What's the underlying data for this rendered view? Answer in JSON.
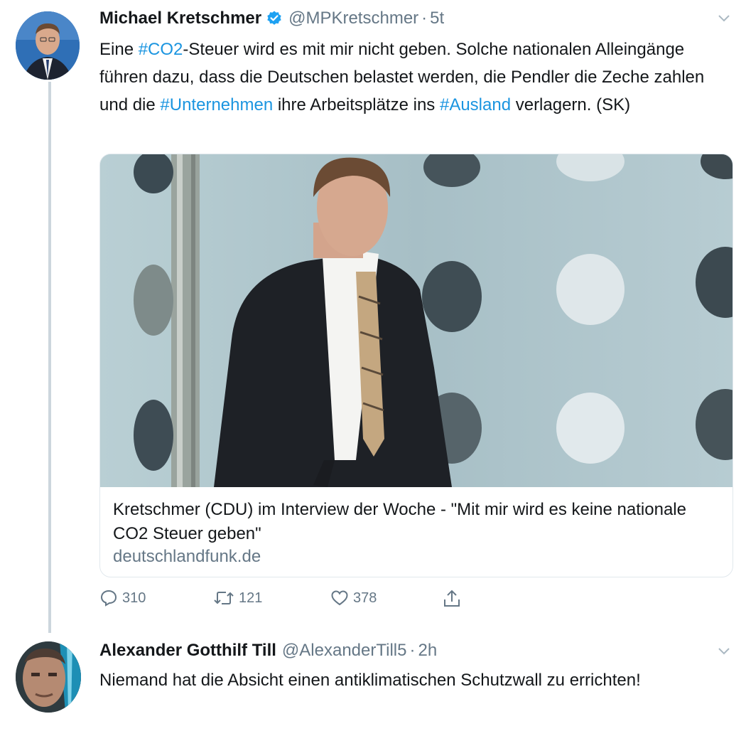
{
  "tweet": {
    "author_name": "Michael Kretschmer",
    "handle": "@MPKretschmer",
    "separator": "·",
    "time": "5t",
    "text_parts": {
      "p1": "Eine ",
      "tag1": "#CO2",
      "p2": "-Steuer wird es mit mir nicht geben. Solche nationalen Alleingänge führen dazu, dass die Deutschen belastet werden, die Pendler die Zeche zahlen und die ",
      "tag2": "#Unternehmen",
      "p3": " ihre Arbeitsplätze ins ",
      "tag3": "#Ausland",
      "p4": " verlagern. (SK)"
    },
    "card": {
      "title": "Kretschmer (CDU) im Interview der Woche - \"Mit mir wird es keine nationale CO2 Steuer geben\"",
      "domain": "deutschlandfunk.de"
    },
    "actions": {
      "replies": "310",
      "retweets": "121",
      "likes": "378"
    }
  },
  "reply": {
    "author_name": "Alexander Gotthilf Till",
    "handle": "@AlexanderTill5",
    "separator": "·",
    "time": "2h",
    "text": "Niemand hat die Absicht einen antiklimatischen Schutzwall zu errichten!"
  },
  "colors": {
    "link": "#1b95e0",
    "secondary": "#657786",
    "verified": "#1da1f2",
    "thread_line": "#ccd6dd"
  },
  "icons": [
    "verified-badge-icon",
    "chevron-down-icon",
    "reply-icon",
    "retweet-icon",
    "like-icon",
    "share-icon"
  ]
}
